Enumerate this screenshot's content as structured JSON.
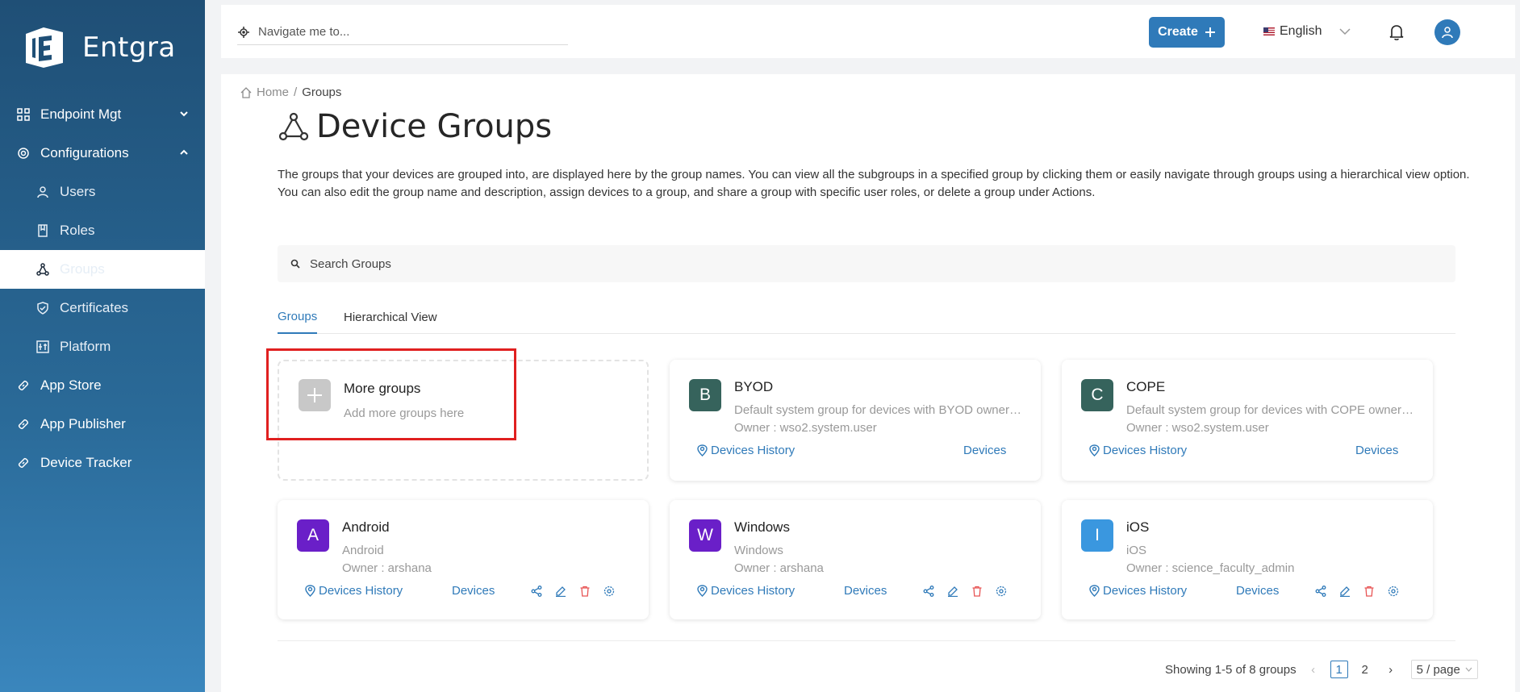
{
  "brand": {
    "name": "Entgra"
  },
  "sidebar": {
    "items": [
      {
        "label": "Endpoint Mgt",
        "icon": "grid-icon",
        "expanded": false
      },
      {
        "label": "Configurations",
        "icon": "gear-icon",
        "expanded": true
      },
      {
        "label": "Users",
        "icon": "user-icon"
      },
      {
        "label": "Roles",
        "icon": "book-icon"
      },
      {
        "label": "Groups",
        "icon": "groups-icon",
        "active": true
      },
      {
        "label": "Certificates",
        "icon": "shield-icon"
      },
      {
        "label": "Platform",
        "icon": "platform-icon"
      },
      {
        "label": "App Store",
        "icon": "link-icon"
      },
      {
        "label": "App Publisher",
        "icon": "link-icon"
      },
      {
        "label": "Device Tracker",
        "icon": "link-icon"
      }
    ]
  },
  "header": {
    "nav_placeholder": "Navigate me to...",
    "create_label": "Create",
    "language": "English"
  },
  "breadcrumb": {
    "home": "Home",
    "separator": "/",
    "current": "Groups"
  },
  "page": {
    "title": "Device Groups",
    "description": "The groups that your devices are grouped into, are displayed here by the group names. You can view all the subgroups in a specified group by clicking them or easily navigate through groups using a hierarchical view option. You can also edit the group name and description, assign devices to a group, and share a group with specific user roles, or delete a group under Actions."
  },
  "search": {
    "placeholder": "Search Groups"
  },
  "tabs": [
    {
      "label": "Groups",
      "active": true
    },
    {
      "label": "Hierarchical View",
      "active": false
    }
  ],
  "more_groups": {
    "title": "More groups",
    "subtitle": "Add more groups here"
  },
  "groups": [
    {
      "letter": "B",
      "name": "BYOD",
      "description": "Default system group for devices with BYOD ownership",
      "owner": "Owner : wso2.system.user",
      "history": "Devices History",
      "devices": "Devices",
      "color": "#36635c"
    },
    {
      "letter": "C",
      "name": "COPE",
      "description": "Default system group for devices with COPE ownership",
      "owner": "Owner : wso2.system.user",
      "history": "Devices History",
      "devices": "Devices",
      "color": "#36635c"
    },
    {
      "letter": "A",
      "name": "Android",
      "description": "Android",
      "owner": "Owner : arshana",
      "history": "Devices History",
      "devices": "Devices",
      "color": "#6a1fc8"
    },
    {
      "letter": "W",
      "name": "Windows",
      "description": "Windows",
      "owner": "Owner : arshana",
      "history": "Devices History",
      "devices": "Devices",
      "color": "#6a1fc8"
    },
    {
      "letter": "I",
      "name": "iOS",
      "description": "iOS",
      "owner": "Owner : science_faculty_admin",
      "history": "Devices History",
      "devices": "Devices",
      "color": "#3a97df"
    }
  ],
  "pagination": {
    "summary": "Showing 1-5 of 8 groups",
    "pages": [
      "1",
      "2"
    ],
    "current": "1",
    "page_size": "5 / page"
  },
  "colors": {
    "accent": "#2f7ab9",
    "danger": "#e85454"
  }
}
